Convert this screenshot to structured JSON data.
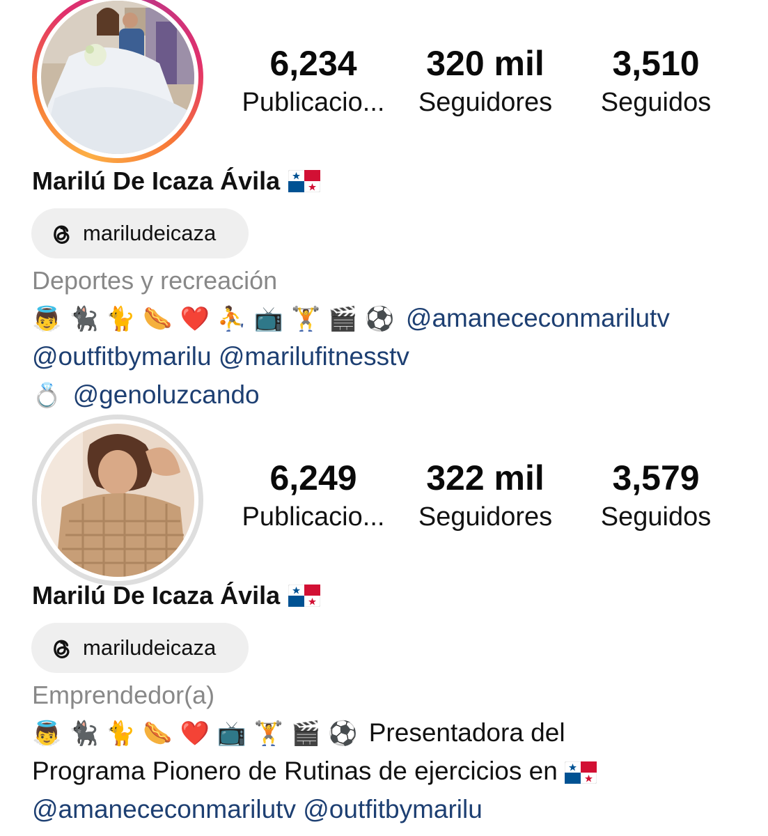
{
  "profile_top": {
    "stats": [
      {
        "value": "6,234",
        "label": "Publicacio..."
      },
      {
        "value": "320 mil",
        "label": "Seguidores"
      },
      {
        "value": "3,510",
        "label": "Seguidos"
      }
    ],
    "name": "Marilú De Icaza Ávila",
    "threads_handle": "mariludeicaza",
    "category": "Deportes y recreación",
    "bio": {
      "line1_emojis": "👼 🐈‍⬛ 🐈 🌭 ❤️ ⛹️ 📺 🏋️ 🎬 ⚽",
      "line1_mention": "@amanececonmarilutv",
      "line2_mention_a": "@outfitbymarilu",
      "line2_mention_b": "@marilufitnesstv",
      "line3_emoji": "💍",
      "line3_mention": "@genoluzcando"
    }
  },
  "profile_bottom": {
    "stats": [
      {
        "value": "6,249",
        "label": "Publicacio..."
      },
      {
        "value": "322 mil",
        "label": "Seguidores"
      },
      {
        "value": "3,579",
        "label": "Seguidos"
      }
    ],
    "name": "Marilú De Icaza Ávila",
    "threads_handle": "mariludeicaza",
    "category": "Emprendedor(a)",
    "bio": {
      "line1_emojis": "👼 🐈‍⬛ 🐈 🌭 ❤️ 📺 🏋️ 🎬 ⚽",
      "line1_text": "Presentadora del",
      "line2_text": "Programa Pionero de Rutinas de ejercicios en",
      "line3_mention_a": "@amanececonmarilutv",
      "line3_mention_b": "@outfitbymarilu"
    }
  },
  "colors": {
    "mention": "#1d3f72",
    "category": "#888888",
    "pill": "#efefef",
    "story_ring": [
      "#fcaf45",
      "#f77737",
      "#e1306c",
      "#c13584"
    ]
  },
  "icons": [
    "threads-icon",
    "panama-flag-icon"
  ]
}
